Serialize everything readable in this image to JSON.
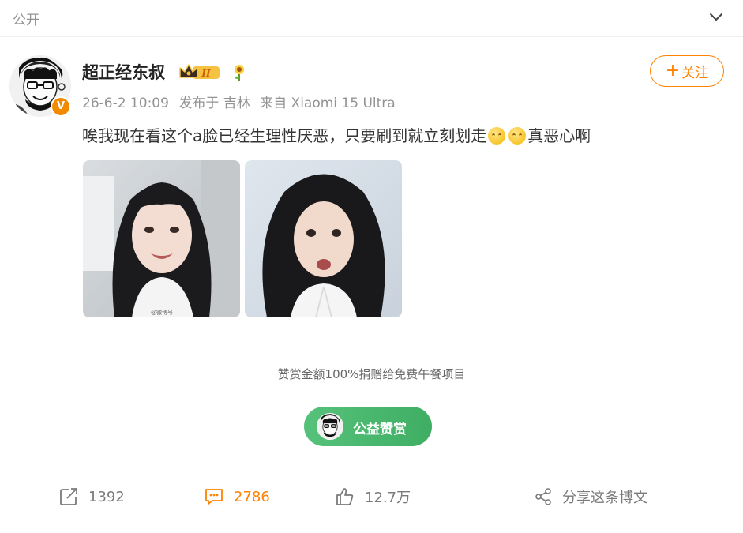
{
  "header": {
    "visibility": "公开"
  },
  "author": {
    "name": "超正经东叔",
    "badge_level": "II",
    "verified_mark": "V"
  },
  "meta": {
    "date": "26-6-2 10:09",
    "location": "发布于 吉林",
    "source": "来自 Xiaomi 15 Ultra"
  },
  "follow": {
    "plus": "+",
    "label": "关注"
  },
  "post": {
    "text_main": "唉我现在看这个a脸已经生理性厌恶，只要刷到就立刻划走",
    "text_end": "真恶心啊",
    "emoji_names": [
      "sad-face-icon",
      "sad-face-icon"
    ]
  },
  "photos": [
    {
      "alt": "photo-1",
      "watermark": "@微博号"
    },
    {
      "alt": "photo-2"
    }
  ],
  "reward": {
    "note": "赞赏金额100%捐赠给免费午餐项目",
    "button_label": "公益赞赏"
  },
  "actions": {
    "repost_count": "1392",
    "comment_count": "2786",
    "like_count": "12.7万",
    "share_label": "分享这条博文"
  },
  "colors": {
    "accent": "#ff8200",
    "reward_green": "#45b36a",
    "muted": "#939393"
  }
}
